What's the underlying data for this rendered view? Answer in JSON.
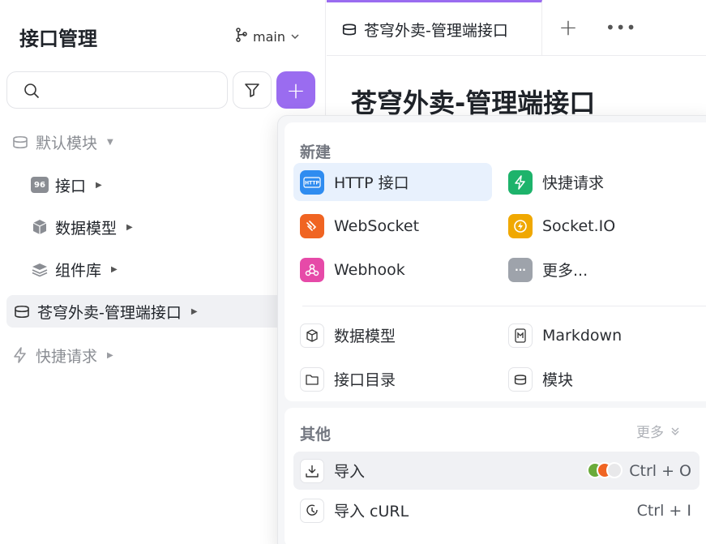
{
  "sidebar": {
    "title": "接口管理",
    "branch": "main",
    "tree": [
      {
        "label": "默认模块",
        "icon": "module-icon"
      },
      {
        "label": "接口",
        "icon": "api-icon"
      },
      {
        "label": "数据模型",
        "icon": "cube-icon"
      },
      {
        "label": "组件库",
        "icon": "layers-icon"
      },
      {
        "label": "苍穹外卖-管理端接口",
        "icon": "module-icon"
      },
      {
        "label": "快捷请求",
        "icon": "lightning-icon"
      }
    ]
  },
  "tabs": [
    {
      "label": "苍穹外卖-管理端接口",
      "icon": "module-icon"
    }
  ],
  "main": {
    "heading": "苍穹外卖-管理端接口"
  },
  "menu": {
    "new_label": "新建",
    "new_items": [
      {
        "label": "HTTP 接口",
        "icon": "http-icon",
        "color": "#2f8cf0"
      },
      {
        "label": "快捷请求",
        "icon": "lightning-icon",
        "color": "#1db36b"
      },
      {
        "label": "WebSocket",
        "icon": "websocket-icon",
        "color": "#f06422"
      },
      {
        "label": "Socket.IO",
        "icon": "socketio-icon",
        "color": "#f0a800"
      },
      {
        "label": "Webhook",
        "icon": "webhook-icon",
        "color": "#e64aa8"
      },
      {
        "label": "更多...",
        "icon": "more-icon",
        "color": "#9ea3ab"
      },
      {
        "label": "数据模型",
        "icon": "cube-icon"
      },
      {
        "label": "Markdown",
        "icon": "markdown-icon"
      },
      {
        "label": "接口目录",
        "icon": "folder-icon"
      },
      {
        "label": "模块",
        "icon": "module-icon"
      }
    ],
    "other_label": "其他",
    "more_label": "更多",
    "other_items": [
      {
        "label": "导入",
        "icon": "import-icon",
        "shortcut": "Ctrl + O"
      },
      {
        "label": "导入 cURL",
        "icon": "curl-icon",
        "shortcut": "Ctrl + I"
      }
    ]
  },
  "colors": {
    "accent": "#9a6cf0",
    "highlight": "#e8f1fd"
  }
}
